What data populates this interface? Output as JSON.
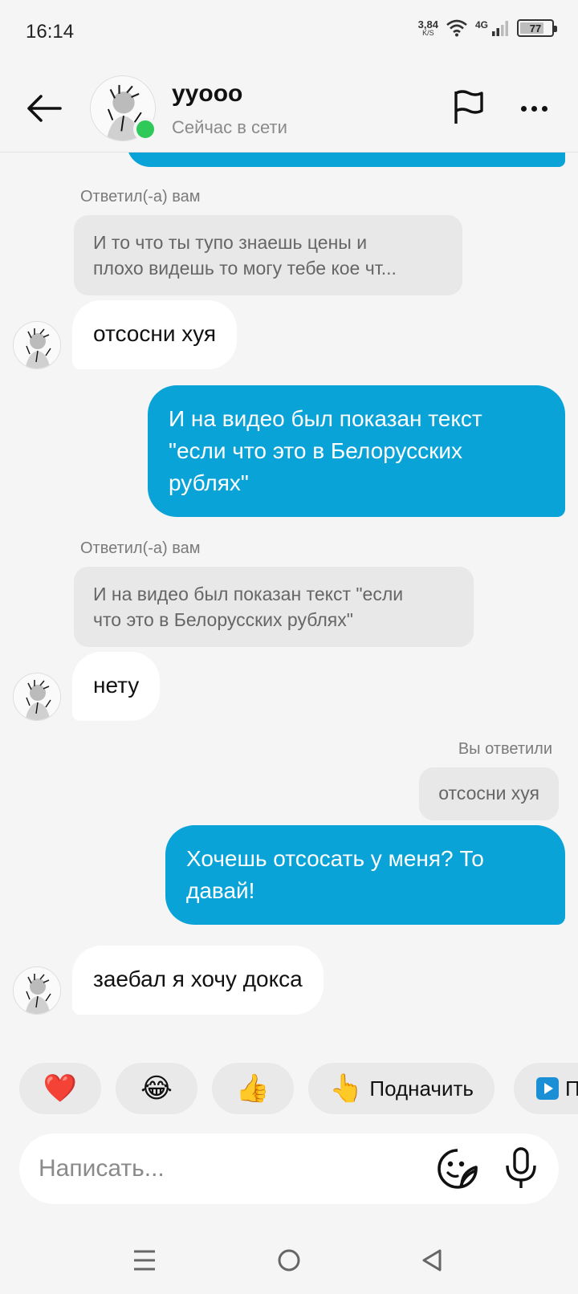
{
  "status_bar": {
    "time": "16:14",
    "net_speed_value": "3,84",
    "net_speed_unit": "K/S",
    "network_type": "4G",
    "battery_level": "77"
  },
  "header": {
    "contact_name": "yyooo",
    "contact_status": "Сейчас в сети",
    "online_color": "#2fc95a"
  },
  "messages": [
    {
      "id": "m1",
      "type": "reply_context",
      "label": "Ответил(-а) вам",
      "quote": "И то что ты тупо знаешь цены и плохо видешь то могу тебе кое чт..."
    },
    {
      "id": "m2",
      "type": "incoming",
      "text": "отсосни хуя"
    },
    {
      "id": "m3",
      "type": "outgoing",
      "lines": [
        "И на видео был показан текст",
        "\"если что это в Белорусских",
        "рублях\""
      ]
    },
    {
      "id": "m4",
      "type": "reply_context",
      "label": "Ответил(-а) вам",
      "quote": "И на видео был показан текст \"если что это в Белорусских рублях\""
    },
    {
      "id": "m5",
      "type": "incoming",
      "text": "нету"
    },
    {
      "id": "m6",
      "type": "own_reply_context",
      "label": "Вы ответили",
      "quote": "отсосни хуя"
    },
    {
      "id": "m7",
      "type": "outgoing",
      "lines": [
        "Хочешь отсосать у меня? То",
        "давай!"
      ]
    },
    {
      "id": "m8",
      "type": "incoming",
      "text": "заебал я хочу докса"
    }
  ],
  "reply_quotes": {
    "q1_line1": "И то что ты тупо знаешь цены и",
    "q1_line2": "плохо видешь то могу тебе кое чт...",
    "q2_line1": "И на видео был показан текст \"если",
    "q2_line2": "что это в Белорусских рублях\""
  },
  "quick_reactions": [
    {
      "icon": "heart-emoji",
      "glyph": "❤️"
    },
    {
      "icon": "tears-of-joy-emoji",
      "glyph": "😂"
    },
    {
      "icon": "thumbs-up-emoji",
      "glyph": "👍"
    },
    {
      "icon": "pointing-hand-emoji",
      "glyph": "👆",
      "label": "Подначить"
    },
    {
      "icon": "play-icon",
      "label": "П"
    }
  ],
  "composer": {
    "placeholder": "Написать..."
  },
  "colors": {
    "outgoing_bubble": "#0aa3d7",
    "incoming_bubble": "#ffffff",
    "reply_box": "#e8e8e8",
    "background": "#f5f5f5"
  }
}
